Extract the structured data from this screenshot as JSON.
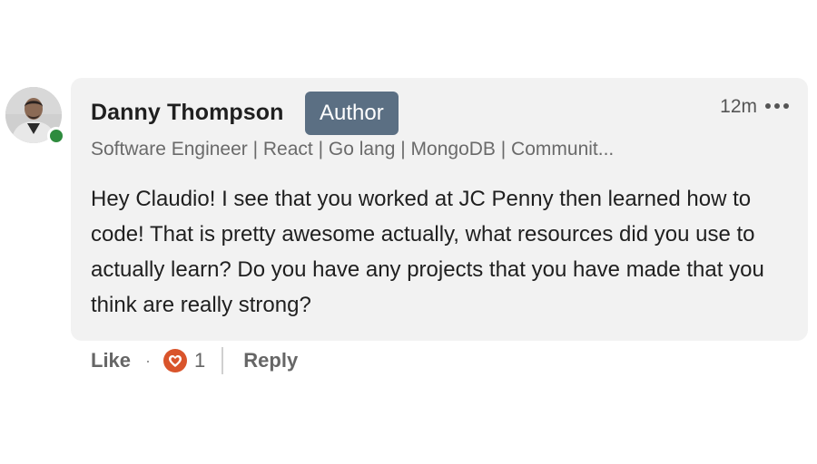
{
  "comment": {
    "author": {
      "name": "Danny Thompson",
      "badge": "Author",
      "headline": "Software Engineer | React | Go lang | MongoDB | Communit...",
      "online": true,
      "avatar_icon": "user-avatar-photo"
    },
    "timestamp": "12m",
    "more_icon": "ellipsis-icon",
    "body": "Hey Claudio! I see that you worked at JC Penny then learned how to code! That is pretty awesome actually, what resources did you use to actually learn? Do you have any projects that you have made that you think are really strong?",
    "actions": {
      "like_label": "Like",
      "separator": "·",
      "reaction_icon": "heart-icon",
      "reaction_count": "1",
      "reply_label": "Reply"
    }
  },
  "colors": {
    "bubble_bg": "#f2f2f2",
    "badge_bg": "#5b6f83",
    "presence_green": "#2e8b3e",
    "heart_red": "#d9542b"
  }
}
